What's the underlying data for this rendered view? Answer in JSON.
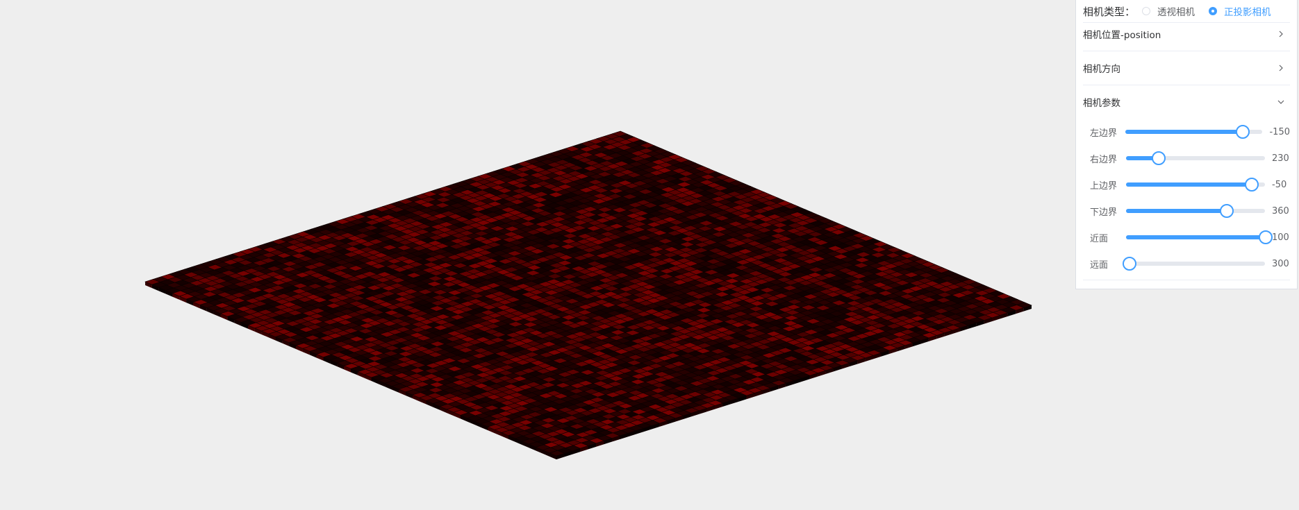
{
  "colors": {
    "background": "#eeeeee",
    "accent": "#409eff",
    "tile_dark": "#0f0000",
    "tile_red": "#7a0000"
  },
  "scene": {
    "object": "grid-of-boxes",
    "style": "orthographic-dark-red-tiles"
  },
  "panel": {
    "camera_type_label": "相机类型：",
    "camera_types": [
      {
        "label": "透视相机",
        "checked": false
      },
      {
        "label": "正投影相机",
        "checked": true
      }
    ],
    "sections": [
      {
        "title": "相机位置-position",
        "expanded": false,
        "icon": "chevron-right-icon"
      },
      {
        "title": "相机方向",
        "expanded": false,
        "icon": "chevron-right-icon"
      },
      {
        "title": "相机参数",
        "expanded": true,
        "icon": "chevron-down-icon"
      }
    ],
    "sliders": [
      {
        "label": "左边界",
        "value": "-150",
        "fraction": 0.85
      },
      {
        "label": "右边界",
        "value": "230",
        "fraction": 0.23
      },
      {
        "label": "上边界",
        "value": "-50",
        "fraction": 0.9
      },
      {
        "label": "下边界",
        "value": "360",
        "fraction": 0.72
      },
      {
        "label": "近面",
        "value": "100",
        "fraction": 1.0
      },
      {
        "label": "远面",
        "value": "300",
        "fraction": 0.02
      }
    ]
  }
}
